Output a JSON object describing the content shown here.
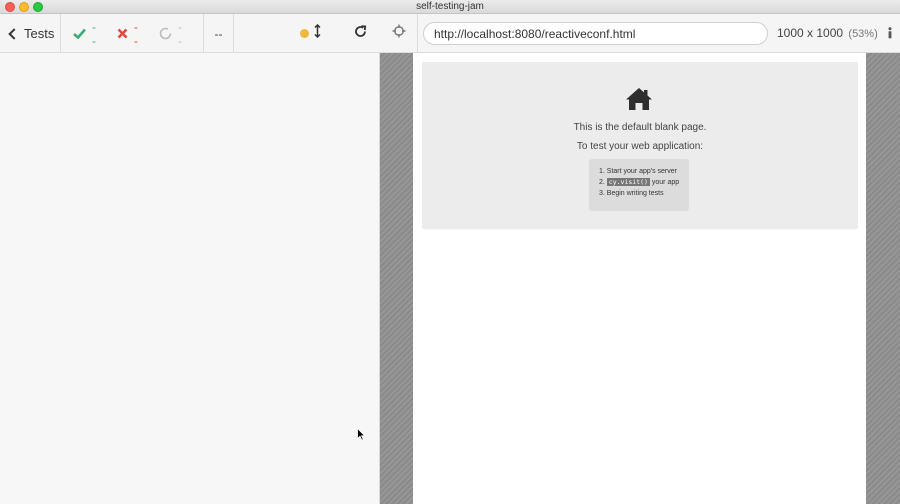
{
  "window": {
    "title": "self-testing-jam"
  },
  "reporter": {
    "back_label": "Tests",
    "stats": {
      "passed": "--",
      "failed": "--",
      "pending": "--"
    },
    "duration": "--"
  },
  "runner": {
    "url": "http://localhost:8080/reactiveconf.html",
    "viewport": {
      "dims": "1000 x 1000",
      "scale": "(53%)"
    },
    "blank_page": {
      "line1": "This is the default blank page.",
      "line2": "To test your web application:",
      "step1": "1. Start your app's server",
      "step2_prefix": "2.",
      "step2_code": "cy.visit()",
      "step2_suffix": "your app",
      "step3": "3. Begin writing tests"
    }
  },
  "colors": {
    "passed": "#3dab74",
    "failed": "#e0483c",
    "indicator": "#f0b93c"
  },
  "icons": [
    "chevron-left-icon",
    "check-icon",
    "x-icon",
    "spinner-icon",
    "dot-indicator-icon",
    "resize-vertical-icon",
    "reload-icon",
    "crosshair-icon",
    "info-icon",
    "home-icon",
    "mouse-cursor-icon"
  ]
}
